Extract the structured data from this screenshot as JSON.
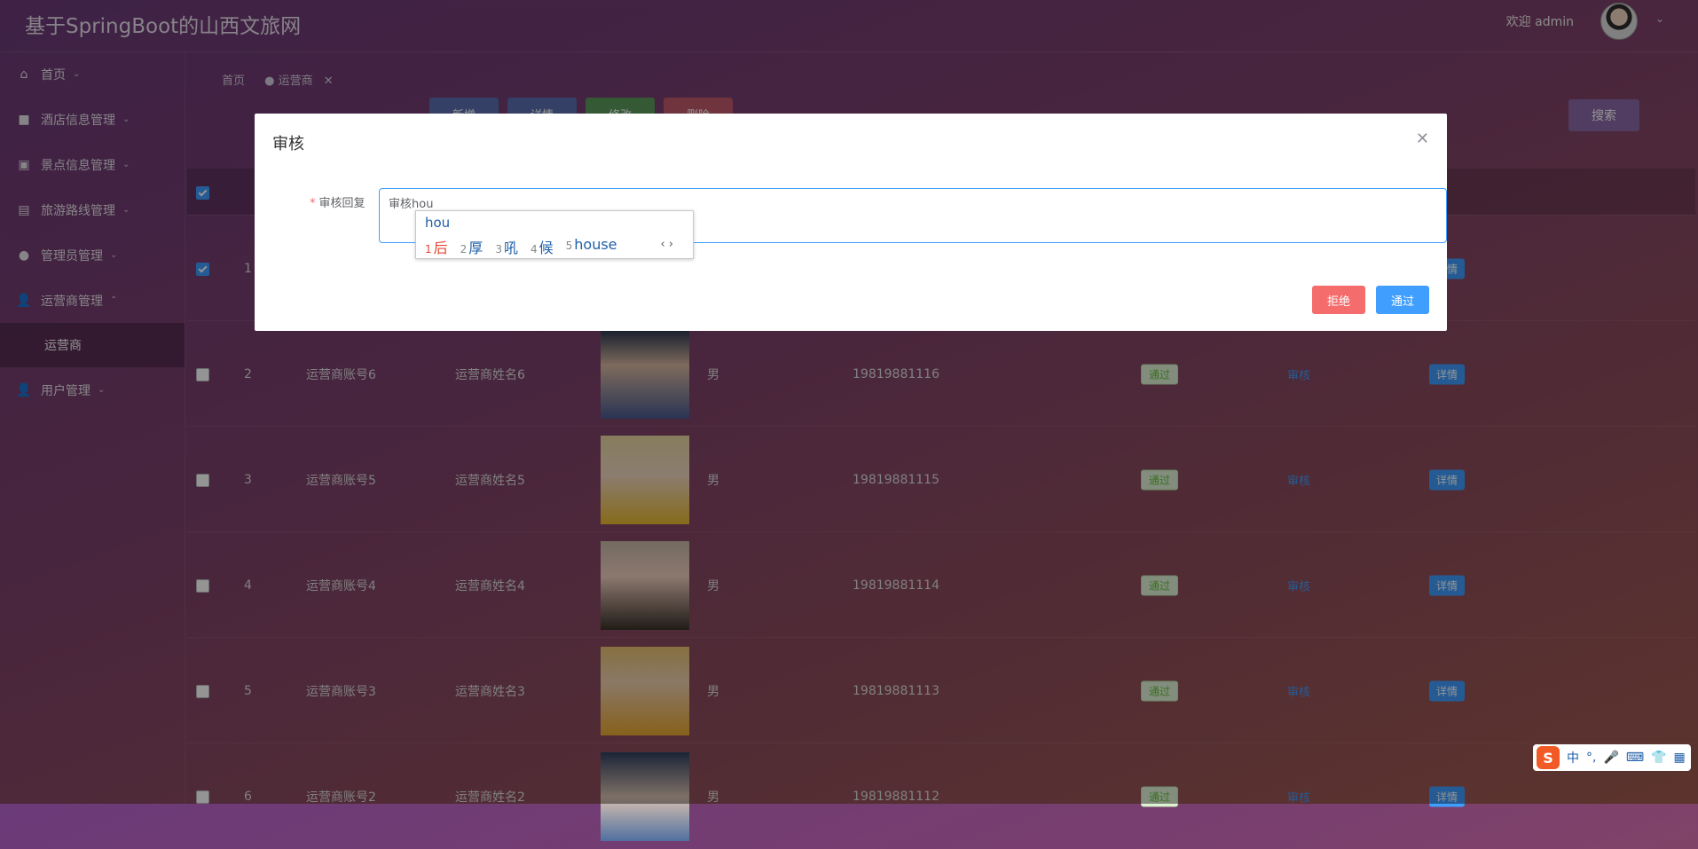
{
  "header": {
    "title": "基于SpringBoot的山西文旅网",
    "welcome": "欢迎 admin"
  },
  "sidebar": {
    "items": [
      {
        "label": "首页",
        "icon": "home-icon"
      },
      {
        "label": "酒店信息管理",
        "icon": "hotel-icon"
      },
      {
        "label": "景点信息管理",
        "icon": "scenery-icon"
      },
      {
        "label": "旅游路线管理",
        "icon": "route-icon"
      },
      {
        "label": "管理员管理",
        "icon": "admin-icon"
      },
      {
        "label": "运营商管理",
        "icon": "user-icon"
      },
      {
        "label": "用户管理",
        "icon": "user-icon"
      }
    ],
    "sub_item": "运营商"
  },
  "tabs": {
    "home": "首页",
    "active": "运营商"
  },
  "toolbar": {
    "add": "新增",
    "detail": "详情",
    "edit": "修改",
    "delete": "删除",
    "search": "搜索"
  },
  "table": {
    "rows": [
      {
        "index": "2",
        "account": "运营商账号6",
        "name": "运营商姓名6",
        "gender": "男",
        "phone": "19819881116",
        "status": "通过",
        "audit": "审核",
        "detail": "详情"
      },
      {
        "index": "3",
        "account": "运营商账号5",
        "name": "运营商姓名5",
        "gender": "男",
        "phone": "19819881115",
        "status": "通过",
        "audit": "审核",
        "detail": "详情"
      },
      {
        "index": "4",
        "account": "运营商账号4",
        "name": "运营商姓名4",
        "gender": "男",
        "phone": "19819881114",
        "status": "通过",
        "audit": "审核",
        "detail": "详情"
      },
      {
        "index": "5",
        "account": "运营商账号3",
        "name": "运营商姓名3",
        "gender": "男",
        "phone": "19819881113",
        "status": "通过",
        "audit": "审核",
        "detail": "详情"
      },
      {
        "index": "6",
        "account": "运营商账号2",
        "name": "运营商姓名2",
        "gender": "男",
        "phone": "19819881112",
        "status": "通过",
        "audit": "审核",
        "detail": "详情"
      }
    ],
    "row1_index": "1",
    "row1_detail": "详情"
  },
  "dialog": {
    "title": "审核",
    "label": "审核回复",
    "value": "审核hou",
    "reject": "拒绝",
    "pass": "通过"
  },
  "ime": {
    "composition": "hou",
    "candidates": [
      {
        "n": "1",
        "text": "后"
      },
      {
        "n": "2",
        "text": "厚"
      },
      {
        "n": "3",
        "text": "吼"
      },
      {
        "n": "4",
        "text": "候"
      },
      {
        "n": "5",
        "text": "house"
      }
    ],
    "bar_mode": "中"
  }
}
